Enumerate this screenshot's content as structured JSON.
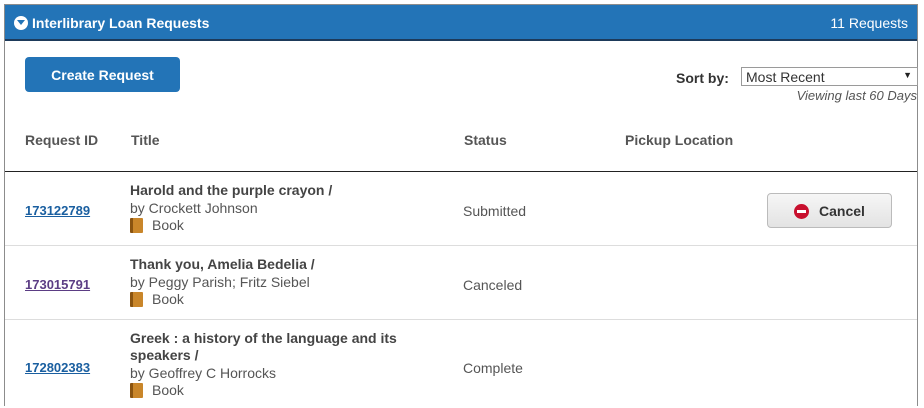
{
  "header": {
    "title": "Interlibrary Loan Requests",
    "count": "11 Requests"
  },
  "toolbar": {
    "create_label": "Create Request",
    "sort_label": "Sort by:",
    "sort_value": "Most Recent",
    "viewing": "Viewing last 60 Days"
  },
  "table": {
    "columns": [
      "Request ID",
      "Title",
      "Status",
      "Pickup Location"
    ],
    "rows": [
      {
        "id": "173122789",
        "title": "Harold and the purple crayon /",
        "title_line2": "",
        "author": "by Crockett Johnson",
        "format": "Book",
        "status": "Submitted",
        "action": "Cancel"
      },
      {
        "id": "173015791",
        "title": "Thank you, Amelia Bedelia /",
        "title_line2": "",
        "author": "by Peggy Parish; Fritz Siebel",
        "format": "Book",
        "status": "Canceled"
      },
      {
        "id": "172802383",
        "title": "Greek : a history of the language and its",
        "title_line2": "speakers /",
        "author": "by Geoffrey C Horrocks",
        "format": "Book",
        "status": "Complete"
      }
    ]
  },
  "icons": {
    "toggle": "chevron-down-circle-icon",
    "format": "book-icon",
    "cancel": "no-entry-icon"
  },
  "colors": {
    "header_bg": "#2374b7",
    "link": "#1a5fa0",
    "visited_link": "#5b3d84",
    "cancel_icon": "#c8102e"
  }
}
